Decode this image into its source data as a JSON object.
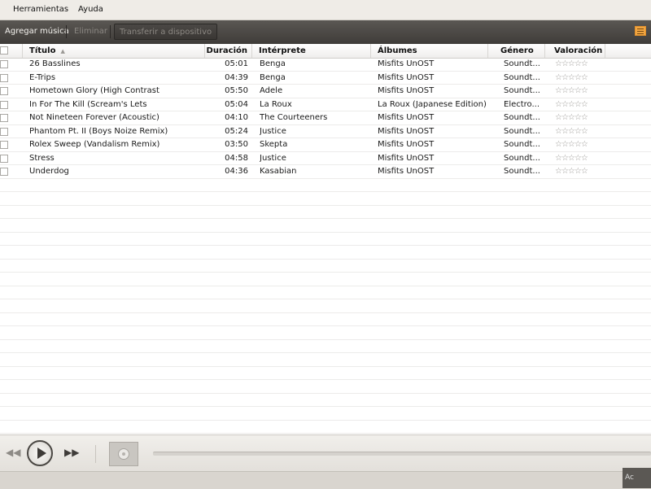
{
  "menu": {
    "items": [
      {
        "label": "Herramientas"
      },
      {
        "label": "Ayuda"
      }
    ]
  },
  "toolbar": {
    "add_label": "Agregar música",
    "remove_label": "Eliminar",
    "transfer_label": "Transferir a dispositivo",
    "view_icon": "list-view-icon"
  },
  "table": {
    "columns": {
      "title": "Título",
      "duration": "Duración",
      "artist": "Intérprete",
      "album": "Álbumes",
      "genre": "Género",
      "rating": "Valoración"
    },
    "sorted_by": "title",
    "rows": [
      {
        "title": "26 Basslines",
        "duration": "05:01",
        "artist": "Benga",
        "album": "Misfits UnOST",
        "genre": "Soundt...",
        "rating": "☆☆☆☆☆"
      },
      {
        "title": "E-Trips",
        "duration": "04:39",
        "artist": "Benga",
        "album": "Misfits UnOST",
        "genre": "Soundt...",
        "rating": "☆☆☆☆☆"
      },
      {
        "title": "Hometown Glory (High Contrast",
        "duration": "05:50",
        "artist": "Adele",
        "album": "Misfits UnOST",
        "genre": "Soundt...",
        "rating": "☆☆☆☆☆"
      },
      {
        "title": "In For The Kill (Scream's Lets",
        "duration": "05:04",
        "artist": "La Roux",
        "album": "La Roux (Japanese Edition)",
        "genre": "Electro...",
        "rating": "☆☆☆☆☆"
      },
      {
        "title": "Not Nineteen Forever (Acoustic)",
        "duration": "04:10",
        "artist": "The Courteeners",
        "album": "Misfits UnOST",
        "genre": "Soundt...",
        "rating": "☆☆☆☆☆"
      },
      {
        "title": "Phantom Pt. II (Boys Noize Remix)",
        "duration": "05:24",
        "artist": "Justice",
        "album": "Misfits UnOST",
        "genre": "Soundt...",
        "rating": "☆☆☆☆☆"
      },
      {
        "title": "Rolex Sweep (Vandalism Remix)",
        "duration": "03:50",
        "artist": "Skepta",
        "album": "Misfits UnOST",
        "genre": "Soundt...",
        "rating": "☆☆☆☆☆"
      },
      {
        "title": "Stress",
        "duration": "04:58",
        "artist": "Justice",
        "album": "Misfits UnOST",
        "genre": "Soundt...",
        "rating": "☆☆☆☆☆"
      },
      {
        "title": "Underdog",
        "duration": "04:36",
        "artist": "Kasabian",
        "album": "Misfits UnOST",
        "genre": "Soundt...",
        "rating": "☆☆☆☆☆"
      }
    ]
  },
  "player": {
    "prev_icon": "rewind-icon",
    "play_icon": "play-icon",
    "next_icon": "fast-forward-icon",
    "album_art_icon": "disc-icon"
  },
  "statusbar": {
    "corner_text": "Ac"
  },
  "colors": {
    "toolbar_bg": "#4a4744",
    "accent": "#f0a541"
  }
}
